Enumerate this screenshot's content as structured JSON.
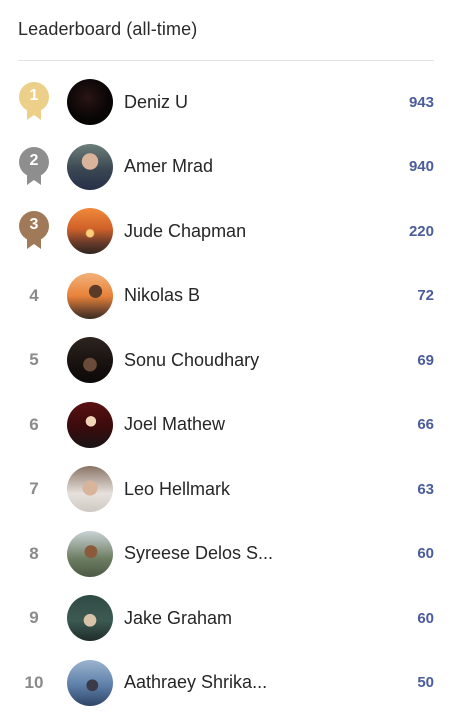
{
  "header": {
    "title": "Leaderboard (all-time)"
  },
  "entries": [
    {
      "rank": "1",
      "medal": "gold",
      "medal_color": "#ecd089",
      "avatar": "dark-avatar",
      "name": "Deniz U",
      "score": "943"
    },
    {
      "rank": "2",
      "medal": "silver",
      "medal_color": "#8e8e8e",
      "avatar": "portrait-avatar",
      "name": "Amer Mrad",
      "score": "940"
    },
    {
      "rank": "3",
      "medal": "bronze",
      "medal_color": "#a07a58",
      "avatar": "sunset-avatar",
      "name": "Jude Chapman",
      "score": "220"
    },
    {
      "rank": "4",
      "medal": "",
      "avatar": "sunset-silhouette-avatar",
      "name": "Nikolas B",
      "score": "72"
    },
    {
      "rank": "5",
      "medal": "",
      "avatar": "dark-poster-avatar",
      "name": "Sonu Choudhary",
      "score": "69"
    },
    {
      "rank": "6",
      "medal": "",
      "avatar": "red-figure-avatar",
      "name": "Joel Mathew",
      "score": "66"
    },
    {
      "rank": "7",
      "medal": "",
      "avatar": "selfie-avatar",
      "name": "Leo Hellmark",
      "score": "63"
    },
    {
      "rank": "8",
      "medal": "",
      "avatar": "outdoor-avatar",
      "name": "Syreese Delos S...",
      "score": "60"
    },
    {
      "rank": "9",
      "medal": "",
      "avatar": "green-avatar",
      "name": "Jake Graham",
      "score": "60"
    },
    {
      "rank": "10",
      "medal": "",
      "avatar": "blue-avatar",
      "name": "Aathraey Shrika...",
      "score": "50"
    }
  ],
  "colors": {
    "score": "#4a5c9a",
    "rank_text": "#8a8a8a"
  }
}
